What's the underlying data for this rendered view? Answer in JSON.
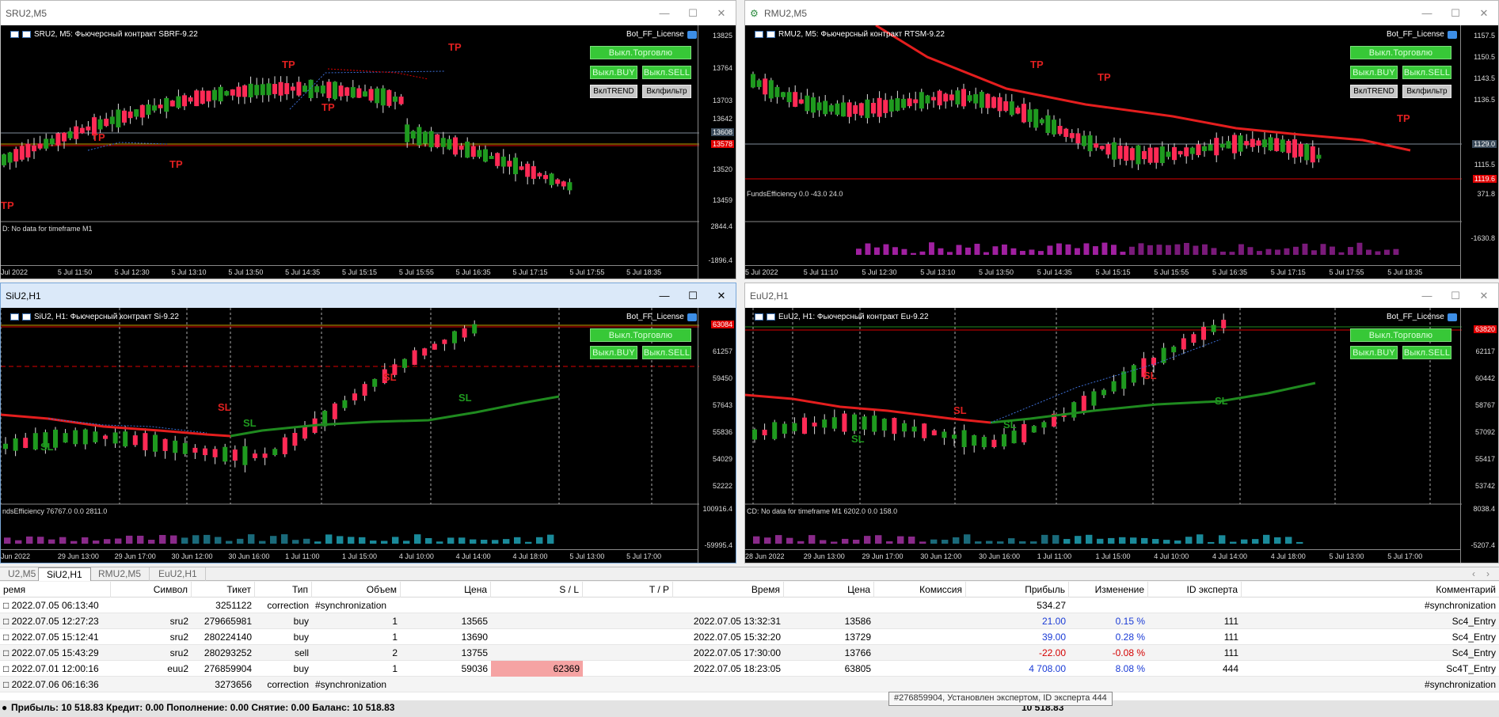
{
  "windows": [
    {
      "title": "SRU2,M5",
      "caption": "SRU2, M5:  Фьючерсный контракт SBRF-9.22",
      "bot": "Bot_FF_License",
      "axis": [
        "13825",
        "13764",
        "13703",
        "13642",
        "13520",
        "13459"
      ],
      "price_gray": "13608",
      "price_red": "13578",
      "sub_axis": [
        "2844.4",
        "-1896.4"
      ],
      "sub_text": "D: No data for timeframe M1",
      "times": [
        "Jul 2022",
        "5 Jul 11:50",
        "5 Jul 12:30",
        "5 Jul 13:10",
        "5 Jul 13:50",
        "5 Jul 14:35",
        "5 Jul 15:15",
        "5 Jul 15:55",
        "5 Jul 16:35",
        "5 Jul 17:15",
        "5 Jul 17:55",
        "5 Jul 18:35"
      ],
      "btn_trade": "Выкл.Торговлю",
      "btn_buy": "Выкл.BUY",
      "btn_sell": "Выкл.SELL",
      "btn_trend": "ВклTREND",
      "btn_filter": "Вклфильтр"
    },
    {
      "title": "RMU2,M5",
      "caption": "RMU2, M5:  Фьючерсный контракт RTSM-9.22",
      "bot": "Bot_FF_License",
      "axis": [
        "1157.5",
        "1150.5",
        "1143.5",
        "1136.5",
        "1115.5"
      ],
      "price_gray": "1129.0",
      "price_red": "1119.6",
      "sub_axis": [
        "371.8",
        "-1630.8"
      ],
      "sub_text": "FundsEfficiency 0.0 -43.0 24.0",
      "times": [
        "5 Jul 2022",
        "5 Jul 11:10",
        "5 Jul 12:30",
        "5 Jul 13:10",
        "5 Jul 13:50",
        "5 Jul 14:35",
        "5 Jul 15:15",
        "5 Jul 15:55",
        "5 Jul 16:35",
        "5 Jul 17:15",
        "5 Jul 17:55",
        "5 Jul 18:35"
      ],
      "btn_trade": "Выкл.Торговлю",
      "btn_buy": "Выкл.BUY",
      "btn_sell": "Выкл.SELL",
      "btn_trend": "ВклTREND",
      "btn_filter": "Вклфильтр"
    },
    {
      "title": "SiU2,H1",
      "caption": "SiU2, H1:  Фьючерсный контракт Si-9.22",
      "bot": "Bot_FF_License",
      "axis": [
        "61257",
        "59450",
        "57643",
        "55836",
        "54029",
        "52222"
      ],
      "price_red": "63084",
      "sub_axis": [
        "100916.4",
        "-59995.4"
      ],
      "sub_text": "ndsEfficiency 76767.0 0.0 2811.0",
      "times": [
        "Jun 2022",
        "29 Jun 13:00",
        "29 Jun 17:00",
        "30 Jun 12:00",
        "30 Jun 16:00",
        "1 Jul 11:00",
        "1 Jul 15:00",
        "4 Jul 10:00",
        "4 Jul 14:00",
        "4 Jul 18:00",
        "5 Jul 13:00",
        "5 Jul 17:00"
      ],
      "btn_trade": "Выкл.Торговлю",
      "btn_buy": "Выкл.BUY",
      "btn_sell": "Выкл.SELL"
    },
    {
      "title": "EuU2,H1",
      "caption": "EuU2, H1:  Фьючерсный контракт Eu-9.22",
      "bot": "Bot_FF_License",
      "axis": [
        "62117",
        "60442",
        "58767",
        "57092",
        "55417",
        "53742"
      ],
      "price_red": "63820",
      "sub_axis": [
        "8038.4",
        "-5207.4"
      ],
      "sub_text": "CD: No data for timeframe M1 6202.0 0.0 158.0",
      "times": [
        "28 Jun 2022",
        "29 Jun 13:00",
        "29 Jun 17:00",
        "30 Jun 12:00",
        "30 Jun 16:00",
        "1 Jul 11:00",
        "1 Jul 15:00",
        "4 Jul 10:00",
        "4 Jul 14:00",
        "4 Jul 18:00",
        "5 Jul 13:00",
        "5 Jul 17:00"
      ],
      "btn_trade": "Выкл.Торговлю",
      "btn_buy": "Выкл.BUY",
      "btn_sell": "Выкл.SELL"
    }
  ],
  "labels": {
    "tp": "TP",
    "sl": "SL"
  },
  "tabs": [
    "U2,M5",
    "SiU2,H1",
    "RMU2,M5",
    "EuU2,H1"
  ],
  "grid": {
    "headers": [
      "ремя",
      "Символ",
      "Тикет",
      "Тип",
      "Объем",
      "Цена",
      "S / L",
      "T / P",
      "Время",
      "Цена",
      "Комиссия",
      "Прибыль",
      "Изменение",
      "ID эксперта",
      "Комментарий"
    ],
    "rows": [
      {
        "time": "2022.07.05 06:13:40",
        "symbol": "",
        "ticket": "3251122",
        "type": "correction",
        "volume": "#synchronization",
        "price": "",
        "sl": "",
        "tp": "",
        "time2": "",
        "price2": "",
        "commission": "",
        "profit": "534.27",
        "change": "",
        "expert": "",
        "comment": "#synchronization"
      },
      {
        "time": "2022.07.05 12:27:23",
        "symbol": "sru2",
        "ticket": "279665981",
        "type": "buy",
        "volume": "1",
        "price": "13565",
        "sl": "",
        "tp": "",
        "time2": "2022.07.05 13:32:31",
        "price2": "13586",
        "commission": "",
        "profit": "21.00",
        "change": "0.15 %",
        "expert": "111",
        "comment": "Sc4_Entry"
      },
      {
        "time": "2022.07.05 15:12:41",
        "symbol": "sru2",
        "ticket": "280224140",
        "type": "buy",
        "volume": "1",
        "price": "13690",
        "sl": "",
        "tp": "",
        "time2": "2022.07.05 15:32:20",
        "price2": "13729",
        "commission": "",
        "profit": "39.00",
        "change": "0.28 %",
        "expert": "111",
        "comment": "Sc4_Entry"
      },
      {
        "time": "2022.07.05 15:43:29",
        "symbol": "sru2",
        "ticket": "280293252",
        "type": "sell",
        "volume": "2",
        "price": "13755",
        "sl": "",
        "tp": "",
        "time2": "2022.07.05 17:30:00",
        "price2": "13766",
        "commission": "",
        "profit": "-22.00",
        "change": "-0.08 %",
        "expert": "111",
        "comment": "Sc4_Entry"
      },
      {
        "time": "2022.07.01 12:00:16",
        "symbol": "euu2",
        "ticket": "276859904",
        "type": "buy",
        "volume": "1",
        "price": "59036",
        "sl": "62369",
        "tp": "",
        "time2": "2022.07.05 18:23:05",
        "price2": "63805",
        "commission": "",
        "profit": "4 708.00",
        "change": "8.08 %",
        "expert": "444",
        "comment": "Sc4T_Entry"
      },
      {
        "time": "2022.07.06 06:16:36",
        "symbol": "",
        "ticket": "3273656",
        "type": "correction",
        "volume": "#synchronization",
        "price": "",
        "sl": "",
        "tp": "",
        "time2": "",
        "price2": "",
        "commission": "",
        "profit": "",
        "change": "",
        "expert": "",
        "comment": "#synchronization"
      }
    ]
  },
  "footer": {
    "text": "Прибыль: 10 518.83  Кредит: 0.00  Пополнение: 0.00  Снятие: 0.00  Баланс: 10 518.83",
    "total": "10 518.83"
  },
  "tooltip": "#276859904, Установлен экспертом, ID эксперта 444"
}
